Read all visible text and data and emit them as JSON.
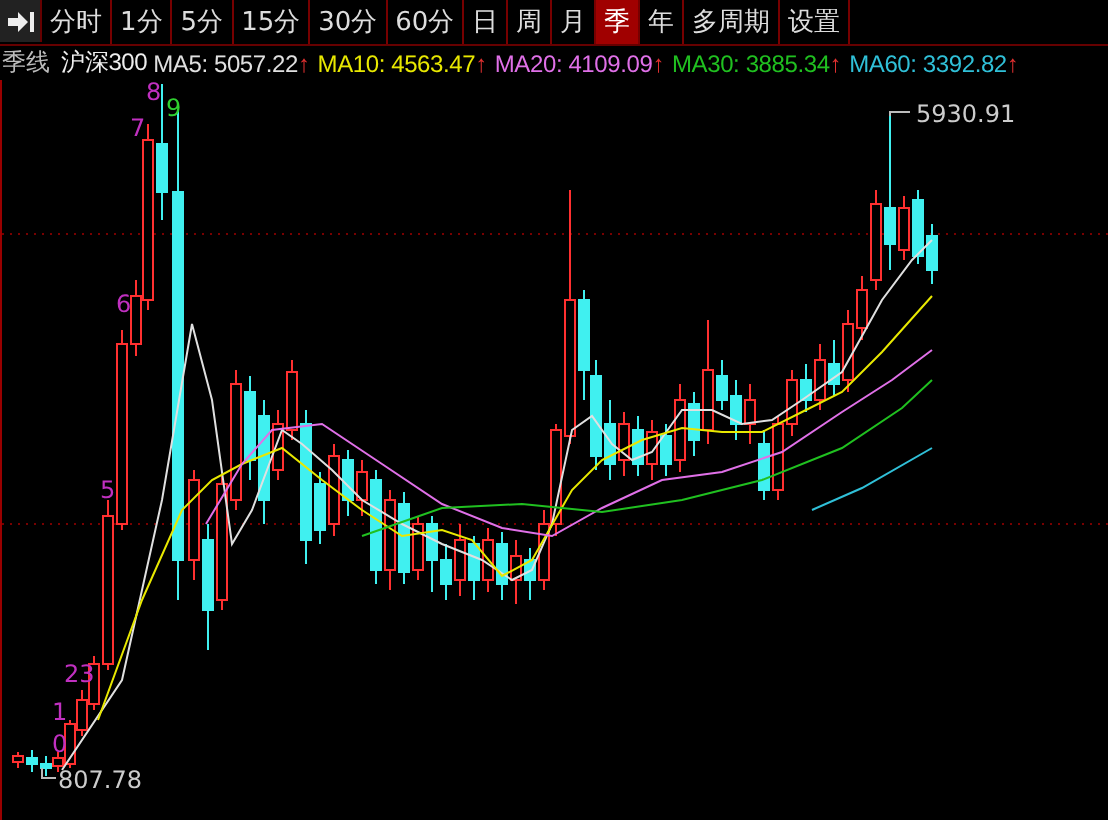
{
  "toolbar": {
    "tabs": [
      {
        "label": "分时",
        "selected": false
      },
      {
        "label": "1分",
        "selected": false
      },
      {
        "label": "5分",
        "selected": false
      },
      {
        "label": "15分",
        "selected": false
      },
      {
        "label": "30分",
        "selected": false
      },
      {
        "label": "60分",
        "selected": false
      },
      {
        "label": "日",
        "selected": false
      },
      {
        "label": "周",
        "selected": false
      },
      {
        "label": "月",
        "selected": false
      },
      {
        "label": "季",
        "selected": true
      },
      {
        "label": "年",
        "selected": false
      },
      {
        "label": "多周期",
        "selected": false
      },
      {
        "label": "设置",
        "selected": false
      }
    ]
  },
  "legend": {
    "period": "季线",
    "index_name": "沪深300",
    "averages": [
      {
        "label": "MA5: 5057.22",
        "trend": "↑",
        "color": "#e0e0e0"
      },
      {
        "label": "MA10: 4563.47",
        "trend": "↑",
        "color": "#e8e800"
      },
      {
        "label": "MA20: 4109.09",
        "trend": "↑",
        "color": "#e070e8"
      },
      {
        "label": "MA30: 3885.34",
        "trend": "↑",
        "color": "#20c020"
      },
      {
        "label": "MA60: 3392.82",
        "trend": "↑",
        "color": "#30c0d8"
      }
    ]
  },
  "chart": {
    "high_label": "5930.91",
    "low_label": "807.78",
    "sequence_marks": [
      {
        "text": "0",
        "color": "#c030c0"
      },
      {
        "text": "1",
        "color": "#c030c0"
      },
      {
        "text": "23",
        "color": "#c030c0"
      },
      {
        "text": "5",
        "color": "#c030c0"
      },
      {
        "text": "6",
        "color": "#c030c0"
      },
      {
        "text": "7",
        "color": "#c030c0"
      },
      {
        "text": "8",
        "color": "#c030c0"
      },
      {
        "text": "9",
        "color": "#30d030"
      }
    ]
  }
}
